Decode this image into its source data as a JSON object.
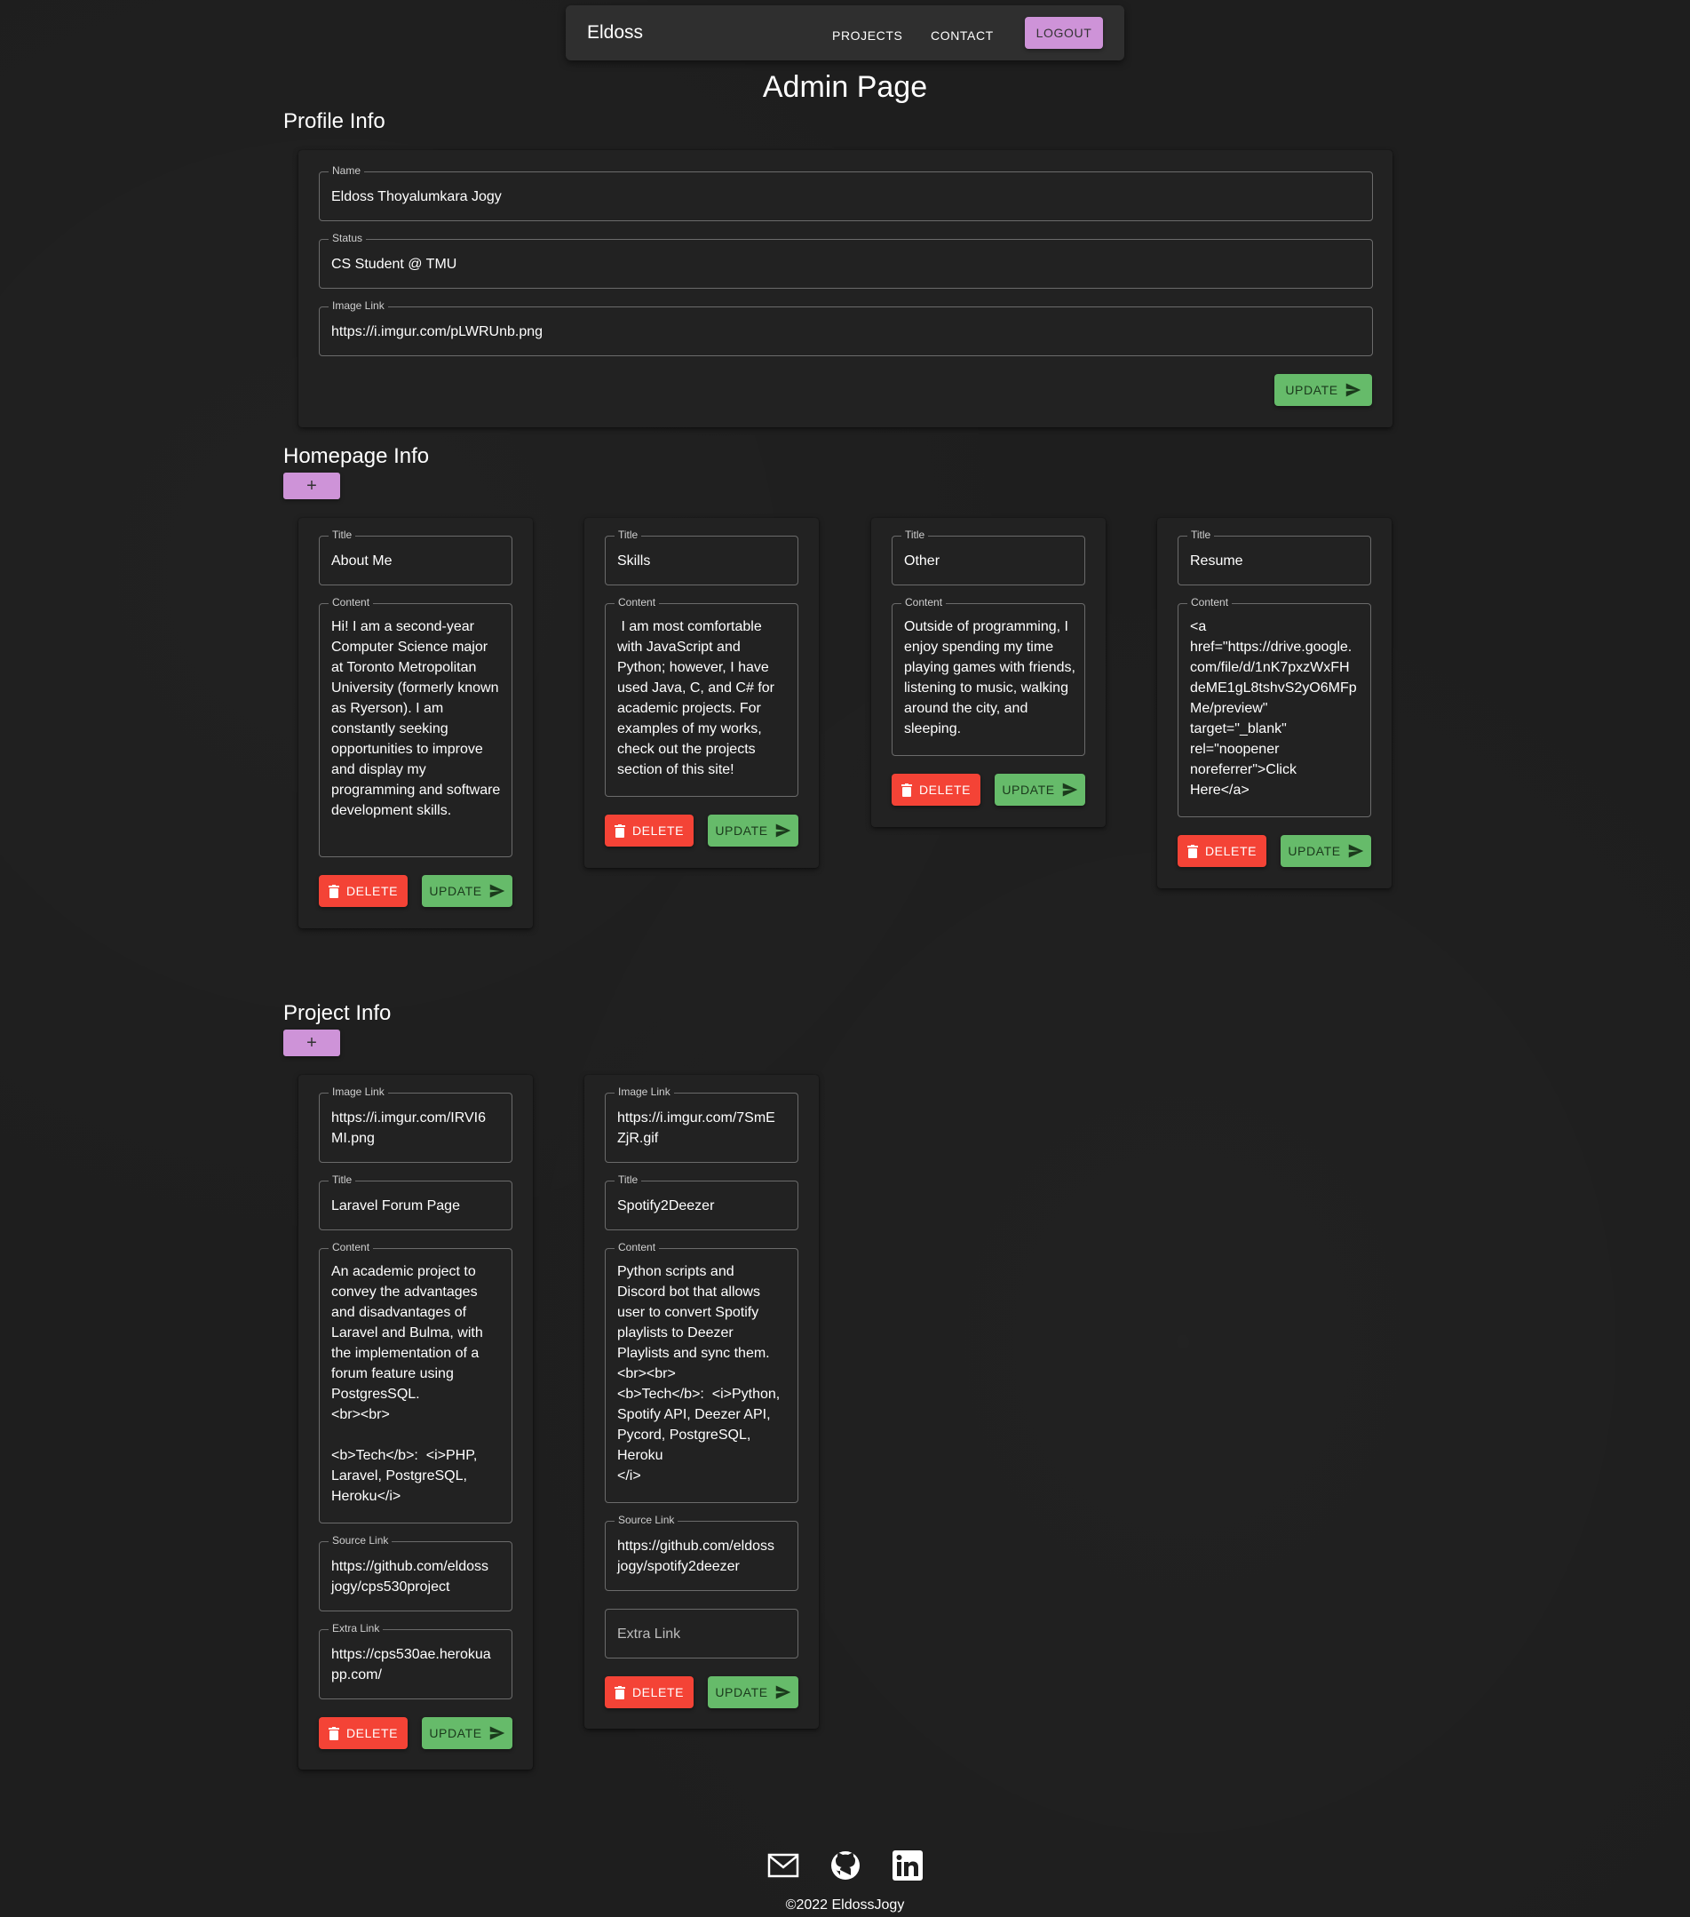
{
  "nav": {
    "brand": "Eldoss",
    "projects": "PROJECTS",
    "contact": "CONTACT",
    "logout": "LOGOUT"
  },
  "page_title": "Admin Page",
  "profile": {
    "section_title": "Profile Info",
    "fields": {
      "name": {
        "label": "Name",
        "value": "Eldoss Thoyalumkara Jogy"
      },
      "status": {
        "label": "Status",
        "value": "CS Student @ TMU"
      },
      "image_link": {
        "label": "Image Link",
        "value": "https://i.imgur.com/pLWRUnb.png"
      }
    },
    "update_label": "UPDATE"
  },
  "homepage": {
    "section_title": "Homepage Info",
    "add_label": "+",
    "title_label": "Title",
    "content_label": "Content",
    "delete_label": "DELETE",
    "update_label": "UPDATE",
    "cards": [
      {
        "title": "About Me",
        "content": "Hi! I am a second-year Computer Science major at Toronto Metropolitan University (formerly known as Ryerson). I am constantly seeking opportunities to improve and display my programming and software development skills."
      },
      {
        "title": "Skills",
        "content": " I am most comfortable with JavaScript and Python; however, I have used Java, C, and C# for academic projects. For examples of my works, check out the projects section of this site!"
      },
      {
        "title": "Other",
        "content": "Outside of programming, I enjoy spending my time playing games with friends, listening to music, walking around the city, and sleeping."
      },
      {
        "title": "Resume",
        "content": "<a\nhref=\"https://drive.google.\ncom/file/d/1nK7pxzWxFH\ndeME1gL8tshvS2yO6MFp\nMe/preview\"\ntarget=\"_blank\"\nrel=\"noopener\nnoreferrer\">Click\nHere</a>"
      }
    ]
  },
  "projects": {
    "section_title": "Project Info",
    "add_label": "+",
    "image_label": "Image Link",
    "title_label": "Title",
    "content_label": "Content",
    "source_label": "Source Link",
    "extra_label": "Extra Link",
    "delete_label": "DELETE",
    "update_label": "UPDATE",
    "cards": [
      {
        "image": "https://i.imgur.com/IRVI6\nMI.png",
        "title": "Laravel Forum Page",
        "content": "An academic project to\nconvey the advantages\nand disadvantages of\nLaravel and Bulma, with\nthe implementation of a\nforum feature using\nPostgresSQL.\n<br><br>\n\n<b>Tech</b>:  <i>PHP,\nLaravel, PostgreSQL,\nHeroku</i>",
        "source": "https://github.com/eldoss\njogy/cps530project",
        "extra": "https://cps530ae.herokua\npp.com/"
      },
      {
        "image": "https://i.imgur.com/7SmE\nZjR.gif",
        "title": "Spotify2Deezer",
        "content": "Python scripts and\nDiscord bot that allows\nuser to convert Spotify\nplaylists to Deezer\nPlaylists and sync them.\n<br><br>\n<b>Tech</b>:  <i>Python,\nSpotify API, Deezer API,\nPycord, PostgreSQL,\nHeroku\n</i>",
        "source": "https://github.com/eldoss\njogy/spotify2deezer",
        "extra": ""
      }
    ]
  },
  "footer": {
    "icons": [
      "mail-icon",
      "github-icon",
      "linkedin-icon"
    ],
    "copyright": "©2022 EldossJogy"
  }
}
